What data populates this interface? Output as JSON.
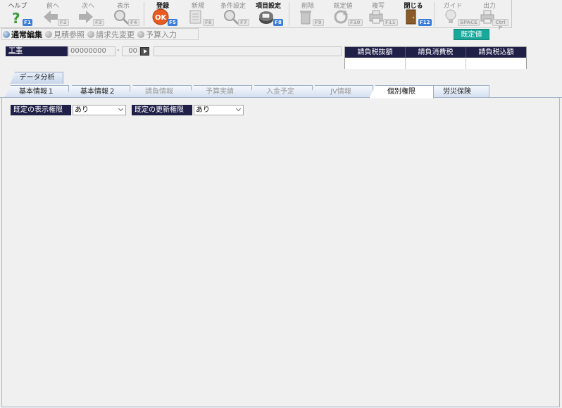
{
  "toolbar": {
    "buttons": [
      {
        "label": "ヘルプ",
        "key": "F1",
        "icon": "help-icon",
        "state": "enabled"
      },
      {
        "label": "前へ",
        "key": "F2",
        "icon": "arrow-left-icon",
        "state": "disabled"
      },
      {
        "label": "次へ",
        "key": "F3",
        "icon": "arrow-right-icon",
        "state": "disabled"
      },
      {
        "label": "表示",
        "key": "F4",
        "icon": "magnifier-icon",
        "state": "disabled"
      },
      {
        "label": "登録",
        "key": "F5",
        "icon": "ok-icon",
        "state": "bold"
      },
      {
        "label": "新規",
        "key": "F6",
        "icon": "new-document-icon",
        "state": "disabled"
      },
      {
        "label": "条件設定",
        "key": "F7",
        "icon": "search-settings-icon",
        "state": "disabled"
      },
      {
        "label": "項目設定",
        "key": "F8",
        "icon": "item-settings-icon",
        "state": "bold"
      },
      {
        "label": "削除",
        "key": "F9",
        "icon": "trash-icon",
        "state": "disabled"
      },
      {
        "label": "既定値",
        "key": "F10",
        "icon": "refresh-icon",
        "state": "disabled"
      },
      {
        "label": "複写",
        "key": "F11",
        "icon": "copy-icon",
        "state": "disabled"
      },
      {
        "label": "閉じる",
        "key": "F12",
        "icon": "door-icon",
        "state": "bold"
      },
      {
        "label": "ガイド",
        "key": "SPACE",
        "icon": "lightbulb-icon",
        "state": "disabled"
      },
      {
        "label": "出力",
        "key": "Ctrl P",
        "icon": "printer-icon",
        "state": "disabled"
      }
    ]
  },
  "modes": [
    {
      "label": "通常編集",
      "active": true
    },
    {
      "label": "見積参照",
      "active": false
    },
    {
      "label": "請求先変更",
      "active": false
    },
    {
      "label": "予算入力",
      "active": false
    }
  ],
  "default_button": "既定値",
  "kouji": {
    "label": "工事",
    "code": "00000000",
    "dash": "-",
    "sub": "00",
    "name": ""
  },
  "summary": {
    "headers": [
      "請負税抜額",
      "請負消費税",
      "請負税込額"
    ],
    "values": [
      "",
      "",
      ""
    ]
  },
  "upper_tab": "データ分析",
  "tabs": [
    {
      "label": "基本情報１",
      "state": "normal"
    },
    {
      "label": "基本情報２",
      "state": "normal"
    },
    {
      "label": "請負情報",
      "state": "disabled"
    },
    {
      "label": "予算実績",
      "state": "disabled"
    },
    {
      "label": "入金予定",
      "state": "disabled"
    },
    {
      "label": "JV情報",
      "state": "disabled"
    },
    {
      "label": "個別権限",
      "state": "active"
    },
    {
      "label": "労災保険",
      "state": "normal"
    }
  ],
  "permissions": {
    "display": {
      "label": "既定の表示権限",
      "value": "あり"
    },
    "update": {
      "label": "既定の更新権限",
      "value": "あり"
    }
  },
  "colors": {
    "header_navy": "#1f1f48",
    "accent_teal": "#19a89a",
    "key_blue": "#3b7dd8"
  }
}
